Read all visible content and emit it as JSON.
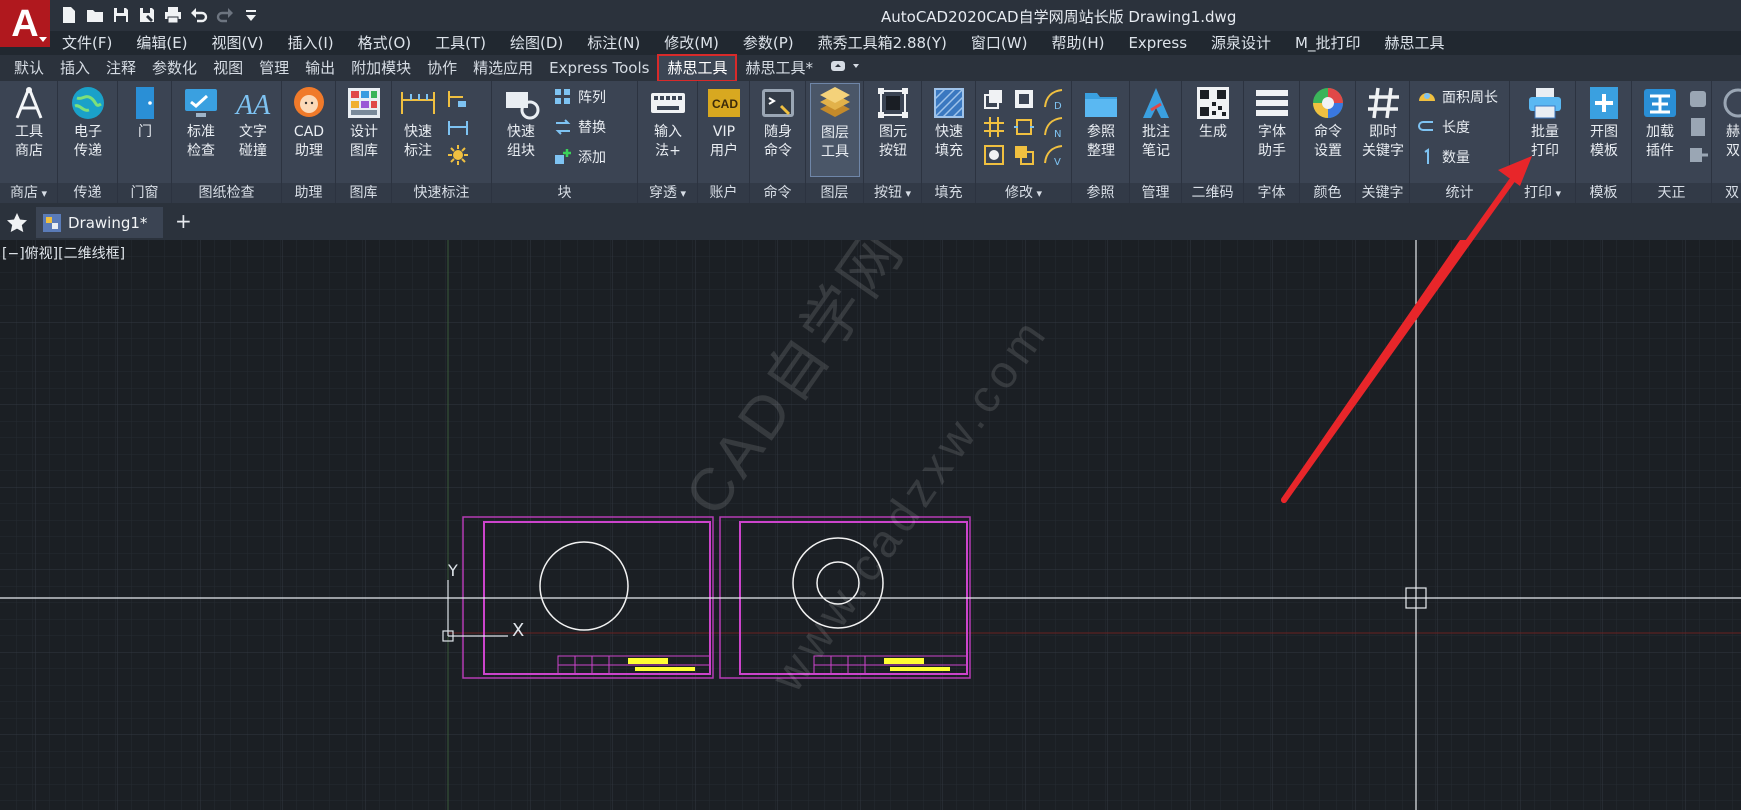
{
  "app": {
    "title": "AutoCAD2020CAD自学网周站长版    Drawing1.dwg",
    "logo_letter": "A",
    "accent": "#b0181e"
  },
  "quick_access": [
    "new-icon",
    "open-icon",
    "save-icon",
    "saveas-icon",
    "plot-icon",
    "undo-icon",
    "redo-icon",
    "customize-icon"
  ],
  "menu": [
    "文件(F)",
    "编辑(E)",
    "视图(V)",
    "插入(I)",
    "格式(O)",
    "工具(T)",
    "绘图(D)",
    "标注(N)",
    "修改(M)",
    "参数(P)",
    "燕秀工具箱2.88(Y)",
    "窗口(W)",
    "帮助(H)",
    "Express",
    "源泉设计",
    "M_批打印",
    "赫思工具"
  ],
  "ribbon_tabs": {
    "items": [
      "默认",
      "插入",
      "注释",
      "参数化",
      "视图",
      "管理",
      "输出",
      "附加模块",
      "协作",
      "精选应用",
      "Express Tools",
      "赫思工具",
      "赫思工具*"
    ],
    "active": "赫思工具"
  },
  "ribbon": {
    "panels": {
      "shop": "商店",
      "transfer": "传递",
      "door": "门窗",
      "check": "图纸检查",
      "helper": "助理",
      "library": "图库",
      "quickdim": "快速标注",
      "block": "块",
      "penetrate": "穿透",
      "account": "账户",
      "command": "命令",
      "layer": "图层",
      "button": "按钮",
      "fill": "填充",
      "modify": "修改",
      "reference": "参照",
      "manage": "管理",
      "qrcode": "二维码",
      "font": "字体",
      "color": "颜色",
      "keyword": "关键字",
      "stats": "统计",
      "print": "打印",
      "template": "模板",
      "tianzheng": "天正",
      "double": "双"
    },
    "buttons": {
      "tool_shop": "工具\n商店",
      "e_transfer": "电子\n传递",
      "door": "门",
      "std_check": "标准\n检查",
      "text_collide": "文字\n碰撞",
      "cad_helper": "CAD\n助理",
      "design_lib": "设计\n图库",
      "quick_dim": "快速\n标注",
      "quick_group": "快速\n组块",
      "array": "阵列",
      "replace": "替换",
      "add": "添加",
      "ime_plus": "输入\n法+",
      "vip_user": "VIP\n用户",
      "follow_cmd": "随身\n命令",
      "layer_tool": "图层\n工具",
      "elem_button": "图元\n按钮",
      "quick_fill": "快速\n填充",
      "ref_sort": "参照\n整理",
      "note_mark": "批注\n笔记",
      "generate": "生成",
      "font_helper": "字体\n助手",
      "cmd_settings": "命令\n设置",
      "instant_kw": "即时\n关键字",
      "area_perimeter": "面积周长",
      "length": "长度",
      "count": "数量",
      "batch_print": "批量\n打印",
      "open_template": "开图\n模板",
      "load_plugin": "加载\n插件",
      "double_partial": "赫\n双"
    }
  },
  "doc_tab": {
    "name": "Drawing1*",
    "add": "+"
  },
  "canvas": {
    "view_label": "[−]俯视][二维线框]",
    "watermark": "CAD自学网",
    "watermark_url": "www.cadzxw.com",
    "ucs_y": "Y",
    "ucs_x": "X",
    "colors": {
      "frame": "#cc44cc",
      "circle": "#ffffff",
      "title_text": "#ffff33",
      "grid": "#2a2f36",
      "arrow": "#e8262a"
    }
  }
}
